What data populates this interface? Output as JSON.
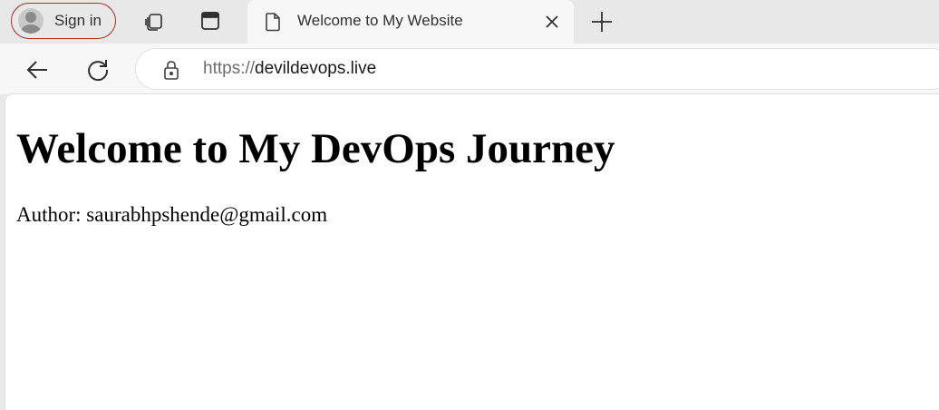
{
  "browser": {
    "sign_in_label": "Sign in",
    "tab": {
      "title": "Welcome to My Website"
    },
    "address": {
      "scheme": "https://",
      "host": "devildevops.live"
    },
    "icons": {
      "profile": "avatar-icon",
      "workspaces": "workspaces-icon",
      "tab_actions": "tab-actions-icon",
      "page": "page-icon",
      "close": "close-icon",
      "new_tab": "plus-icon",
      "back": "back-arrow-icon",
      "reload": "reload-icon",
      "lock": "lock-icon"
    },
    "colors": {
      "signin_outline": "#b02a2a",
      "tabstrip": "#e8e8e8",
      "toolbar": "#f7f7f7"
    }
  },
  "page": {
    "heading": "Welcome to My DevOps Journey",
    "author_line": "Author: saurabhpshende@gmail.com"
  }
}
